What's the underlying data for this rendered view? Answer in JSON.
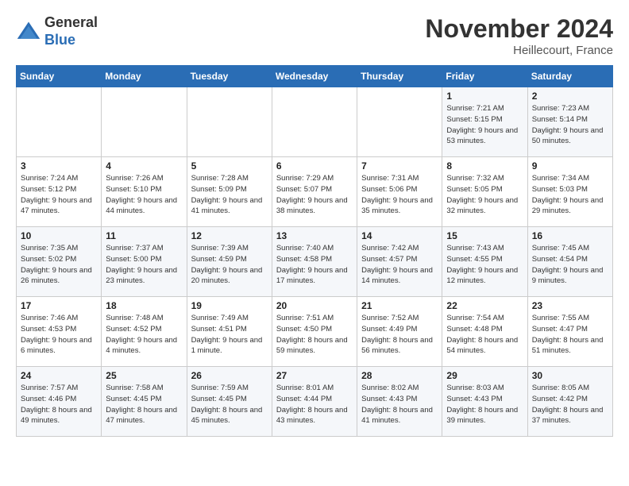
{
  "logo": {
    "general": "General",
    "blue": "Blue"
  },
  "title": "November 2024",
  "location": "Heillecourt, France",
  "days_of_week": [
    "Sunday",
    "Monday",
    "Tuesday",
    "Wednesday",
    "Thursday",
    "Friday",
    "Saturday"
  ],
  "weeks": [
    [
      {
        "day": "",
        "detail": ""
      },
      {
        "day": "",
        "detail": ""
      },
      {
        "day": "",
        "detail": ""
      },
      {
        "day": "",
        "detail": ""
      },
      {
        "day": "",
        "detail": ""
      },
      {
        "day": "1",
        "detail": "Sunrise: 7:21 AM\nSunset: 5:15 PM\nDaylight: 9 hours\nand 53 minutes."
      },
      {
        "day": "2",
        "detail": "Sunrise: 7:23 AM\nSunset: 5:14 PM\nDaylight: 9 hours\nand 50 minutes."
      }
    ],
    [
      {
        "day": "3",
        "detail": "Sunrise: 7:24 AM\nSunset: 5:12 PM\nDaylight: 9 hours\nand 47 minutes."
      },
      {
        "day": "4",
        "detail": "Sunrise: 7:26 AM\nSunset: 5:10 PM\nDaylight: 9 hours\nand 44 minutes."
      },
      {
        "day": "5",
        "detail": "Sunrise: 7:28 AM\nSunset: 5:09 PM\nDaylight: 9 hours\nand 41 minutes."
      },
      {
        "day": "6",
        "detail": "Sunrise: 7:29 AM\nSunset: 5:07 PM\nDaylight: 9 hours\nand 38 minutes."
      },
      {
        "day": "7",
        "detail": "Sunrise: 7:31 AM\nSunset: 5:06 PM\nDaylight: 9 hours\nand 35 minutes."
      },
      {
        "day": "8",
        "detail": "Sunrise: 7:32 AM\nSunset: 5:05 PM\nDaylight: 9 hours\nand 32 minutes."
      },
      {
        "day": "9",
        "detail": "Sunrise: 7:34 AM\nSunset: 5:03 PM\nDaylight: 9 hours\nand 29 minutes."
      }
    ],
    [
      {
        "day": "10",
        "detail": "Sunrise: 7:35 AM\nSunset: 5:02 PM\nDaylight: 9 hours\nand 26 minutes."
      },
      {
        "day": "11",
        "detail": "Sunrise: 7:37 AM\nSunset: 5:00 PM\nDaylight: 9 hours\nand 23 minutes."
      },
      {
        "day": "12",
        "detail": "Sunrise: 7:39 AM\nSunset: 4:59 PM\nDaylight: 9 hours\nand 20 minutes."
      },
      {
        "day": "13",
        "detail": "Sunrise: 7:40 AM\nSunset: 4:58 PM\nDaylight: 9 hours\nand 17 minutes."
      },
      {
        "day": "14",
        "detail": "Sunrise: 7:42 AM\nSunset: 4:57 PM\nDaylight: 9 hours\nand 14 minutes."
      },
      {
        "day": "15",
        "detail": "Sunrise: 7:43 AM\nSunset: 4:55 PM\nDaylight: 9 hours\nand 12 minutes."
      },
      {
        "day": "16",
        "detail": "Sunrise: 7:45 AM\nSunset: 4:54 PM\nDaylight: 9 hours\nand 9 minutes."
      }
    ],
    [
      {
        "day": "17",
        "detail": "Sunrise: 7:46 AM\nSunset: 4:53 PM\nDaylight: 9 hours\nand 6 minutes."
      },
      {
        "day": "18",
        "detail": "Sunrise: 7:48 AM\nSunset: 4:52 PM\nDaylight: 9 hours\nand 4 minutes."
      },
      {
        "day": "19",
        "detail": "Sunrise: 7:49 AM\nSunset: 4:51 PM\nDaylight: 9 hours\nand 1 minute."
      },
      {
        "day": "20",
        "detail": "Sunrise: 7:51 AM\nSunset: 4:50 PM\nDaylight: 8 hours\nand 59 minutes."
      },
      {
        "day": "21",
        "detail": "Sunrise: 7:52 AM\nSunset: 4:49 PM\nDaylight: 8 hours\nand 56 minutes."
      },
      {
        "day": "22",
        "detail": "Sunrise: 7:54 AM\nSunset: 4:48 PM\nDaylight: 8 hours\nand 54 minutes."
      },
      {
        "day": "23",
        "detail": "Sunrise: 7:55 AM\nSunset: 4:47 PM\nDaylight: 8 hours\nand 51 minutes."
      }
    ],
    [
      {
        "day": "24",
        "detail": "Sunrise: 7:57 AM\nSunset: 4:46 PM\nDaylight: 8 hours\nand 49 minutes."
      },
      {
        "day": "25",
        "detail": "Sunrise: 7:58 AM\nSunset: 4:45 PM\nDaylight: 8 hours\nand 47 minutes."
      },
      {
        "day": "26",
        "detail": "Sunrise: 7:59 AM\nSunset: 4:45 PM\nDaylight: 8 hours\nand 45 minutes."
      },
      {
        "day": "27",
        "detail": "Sunrise: 8:01 AM\nSunset: 4:44 PM\nDaylight: 8 hours\nand 43 minutes."
      },
      {
        "day": "28",
        "detail": "Sunrise: 8:02 AM\nSunset: 4:43 PM\nDaylight: 8 hours\nand 41 minutes."
      },
      {
        "day": "29",
        "detail": "Sunrise: 8:03 AM\nSunset: 4:43 PM\nDaylight: 8 hours\nand 39 minutes."
      },
      {
        "day": "30",
        "detail": "Sunrise: 8:05 AM\nSunset: 4:42 PM\nDaylight: 8 hours\nand 37 minutes."
      }
    ]
  ]
}
